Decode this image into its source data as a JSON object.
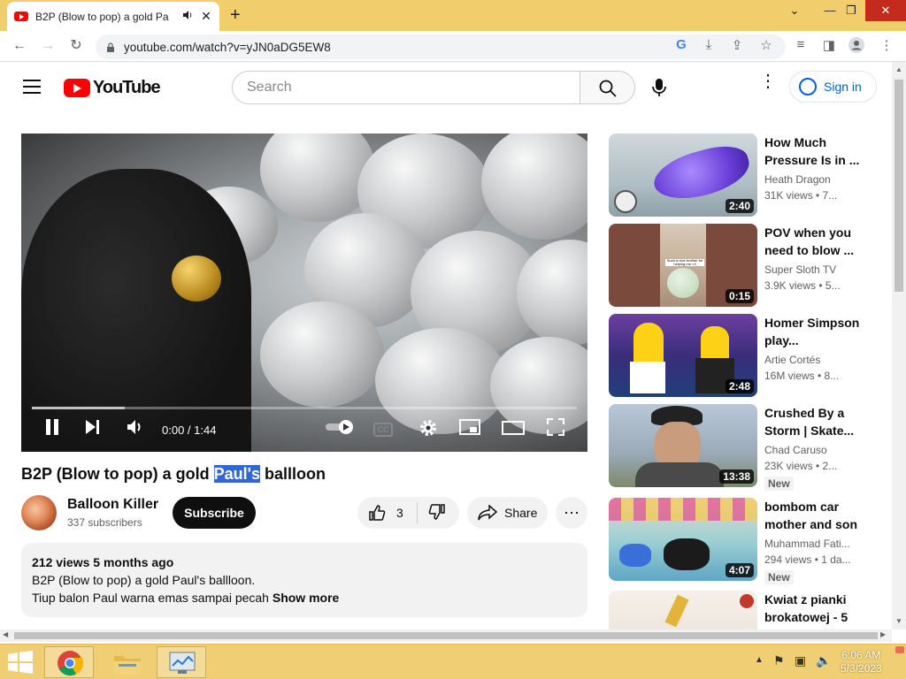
{
  "browser": {
    "tab_title": "B2P (Blow to pop) a gold Pa",
    "new_tab_symbol": "+",
    "url": "youtube.com/watch?v=yJN0aDG5EW8"
  },
  "youtube": {
    "logo_text": "YouTube",
    "search_placeholder": "Search",
    "signin_label": "Sign in"
  },
  "player": {
    "time": "0:00 / 1:44",
    "progress_buffered_fraction": 0.17,
    "cc_label": "CC"
  },
  "video": {
    "title_before": "B2P (Blow to pop) a gold ",
    "title_highlight": "Paul's",
    "title_after": " ballloon",
    "channel_name": "Balloon Killer",
    "subscribers": "337 subscribers",
    "subscribe_label": "Subscribe",
    "likes": "3",
    "share_label": "Share",
    "views_meta": "212 views  5 months ago",
    "description_line1": "B2P (Blow to pop) a gold Paul's ballloon.",
    "description_line2": "Tiup balon Paul warna emas sampai pecah",
    "show_more": "Show more"
  },
  "sidebar": [
    {
      "title": "How Much Pressure Is in ...",
      "channel": "Heath Dragon",
      "views": "31K views  • 7...",
      "duration": "2:40",
      "badge": ""
    },
    {
      "title": "POV when you need to blow ...",
      "channel": "Super Sloth TV",
      "views": "3.9K views  • 5...",
      "duration": "0:15",
      "badge": ""
    },
    {
      "title": "Homer Simpson play...",
      "channel": "Artie Cortés",
      "views": "16M views  • 8...",
      "duration": "2:48",
      "badge": ""
    },
    {
      "title": "Crushed By a Storm | Skate...",
      "channel": "Chad Caruso",
      "views": "23K views  • 2...",
      "duration": "13:38",
      "badge": "New"
    },
    {
      "title": "bombom car mother and son",
      "channel": "Muhammad Fati...",
      "views": "294 views  • 1 da...",
      "duration": "4:07",
      "badge": "New"
    },
    {
      "title": "Kwiat z pianki brokatowej - 5",
      "channel": "",
      "views": "",
      "duration": "",
      "badge": ""
    }
  ],
  "thumb_text": {
    "pov_caption": "Such a nice brother for helping me <3"
  },
  "taskbar": {
    "time": "6:06 AM",
    "date": "5/3/2023"
  },
  "colors": {
    "accent_red": "#ff0000",
    "link_blue": "#065fd4",
    "highlight": "#3166d6",
    "taskbar": "#f0cf74"
  }
}
